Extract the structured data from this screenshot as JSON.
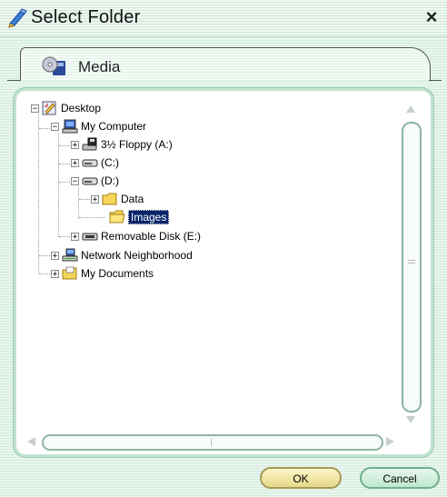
{
  "window": {
    "title": "Select Folder",
    "close_glyph": "×"
  },
  "tab": {
    "label": "Media",
    "icon": "media-icon"
  },
  "tree": {
    "items": [
      {
        "label": "Desktop",
        "icon": "desktop-icon",
        "expander": "−"
      },
      {
        "label": "My Computer",
        "icon": "computer-icon",
        "expander": "−"
      },
      {
        "label": "3½ Floppy (A:)",
        "icon": "floppy-drive-icon",
        "expander": "+"
      },
      {
        "label": "(C:)",
        "icon": "hard-drive-icon",
        "expander": "+"
      },
      {
        "label": "(D:)",
        "icon": "hard-drive-icon",
        "expander": "−"
      },
      {
        "label": "Data",
        "icon": "folder-icon",
        "expander": "+"
      },
      {
        "label": "Images",
        "icon": "open-folder-icon",
        "expander": "",
        "selected": true
      },
      {
        "label": "Removable Disk (E:)",
        "icon": "removable-disk-icon",
        "expander": "+"
      },
      {
        "label": "Network Neighborhood",
        "icon": "network-icon",
        "expander": "+"
      },
      {
        "label": "My Documents",
        "icon": "documents-folder-icon",
        "expander": "+"
      }
    ]
  },
  "buttons": {
    "ok": "OK",
    "cancel": "Cancel"
  },
  "colors": {
    "selection": "#0a246a",
    "ok_fill": "#f3e9a8",
    "cancel_fill": "#cdeedb",
    "panel_border": "#9ccbb0"
  }
}
